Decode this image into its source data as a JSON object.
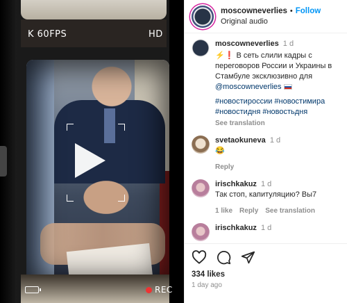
{
  "media": {
    "hud_fps": "K 60FPS",
    "hud_hd": "HD",
    "hud_rec": "REC"
  },
  "header": {
    "username": "moscowneverlies",
    "separator": "•",
    "follow_label": "Follow",
    "audio": "Original audio"
  },
  "post": {
    "username": "moscowneverlies",
    "time": "1 d",
    "caption_text": "⚡❗ В сеть слили кадры с переговоров России и Украины в Стамбуле эксклюзивно для",
    "caption_mention": "@moscowneverlies",
    "hashtags": "#новостироссии #новостимира #новостидня #новостьдня",
    "see_translation": "See translation"
  },
  "comments": [
    {
      "username": "svetaokuneva",
      "time": "1 d",
      "text": "😂",
      "reply": "Reply"
    },
    {
      "username": "irischkakuz",
      "time": "1 d",
      "text": "Так стоп, капитуляцию? Вы7",
      "likes": "1 like",
      "reply": "Reply",
      "see_translation": "See translation"
    },
    {
      "username": "irischkakuz",
      "time": "1 d"
    }
  ],
  "actions": {
    "likes": "334 likes",
    "ago": "1 day ago"
  },
  "colors": {
    "accent": "#0095f6",
    "link": "#00376b",
    "muted": "#8e8e8e",
    "rec_dot": "#ee3333"
  }
}
